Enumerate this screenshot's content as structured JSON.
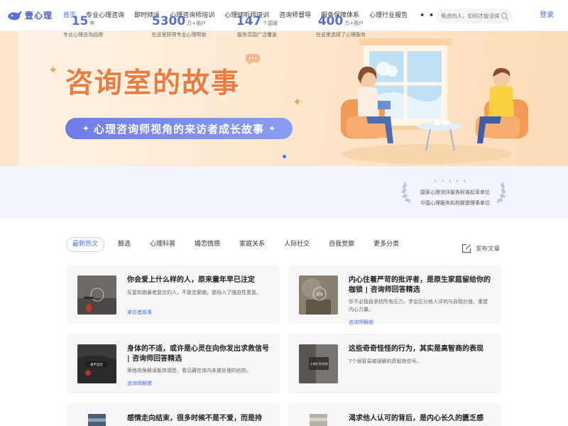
{
  "header": {
    "logo_text": "壹心理",
    "nav": [
      "首页",
      "专业心理咨询",
      "即时倾诉",
      "心理咨询师培训",
      "心理倾听师培训",
      "咨询师督导",
      "服务保障体系",
      "心理行业报告"
    ],
    "more": "• • •",
    "search_placeholder": "焦虑的人，如何才能活得",
    "login": "登录"
  },
  "banner": {
    "title": "咨询室的故事",
    "subtitle": "心理咨询师视角的来访者成长故事"
  },
  "stats": [
    {
      "num": "15",
      "unit": "年",
      "label": "专业心理咨询品牌"
    },
    {
      "num": "5300",
      "unit": "万+用户",
      "label": "在这里获得专业心理帮助"
    },
    {
      "num": "147",
      "unit": "个国家",
      "label": "服务范围广泛覆盖"
    },
    {
      "num": "400",
      "unit": "万+用户",
      "label": "在这里选择了心理服务"
    }
  ],
  "honors": [
    "国家心理测评服务标准起草单位",
    "中国心理服务机构联盟理事单位"
  ],
  "tabs": [
    "最新热文",
    "鲸选",
    "心理科普",
    "婚恋情感",
    "家庭关系",
    "人际社交",
    "自我觉察",
    "更多分类"
  ],
  "publish_label": "发布文章",
  "articles": [
    {
      "title": "你会爱上什么样的人，原来童年早已注定",
      "desc": "反复和施暴者复合的人，不是恋爱脑，是陷入了强迫性重复。",
      "tag": "来访者故事",
      "thumb_text": ""
    },
    {
      "title": "内心住着严苛的批评者，是原生家庭留给你的枷锁 | 咨询师回答精选",
      "desc": "你不必独自承担所有压力，学会区分他人评判与自我价值，重建内心力量。",
      "tag": "咨询师解惑",
      "thumb_text": "咨询"
    },
    {
      "title": "身体的不适，或许是心灵在向你发出求救信号 | 咨询师回答精选",
      "desc": "荣格视角解读躯体感受，看见藏在体内未被处理的创伤。",
      "tag": "咨询师解惑",
      "thumb_text": "来不自在"
    },
    {
      "title": "这些奇奇怪怪的行为，其实是高智商的表现",
      "desc": "7个很容易被误解的高智商信号。",
      "tag": "",
      "thumb_text": "人的行为识别"
    },
    {
      "title": "感情走向结束，很多时候不是不爱，而是持",
      "desc": "",
      "tag": "",
      "thumb_text": ""
    },
    {
      "title": "渴求他人认可的背后，是内心长久的匮乏感",
      "desc": "",
      "tag": "",
      "thumb_text": ""
    }
  ],
  "colors": {
    "accent": "#4a6cf7",
    "banner_title": "#ee7b3b",
    "stat_num": "#5a6fc9"
  }
}
